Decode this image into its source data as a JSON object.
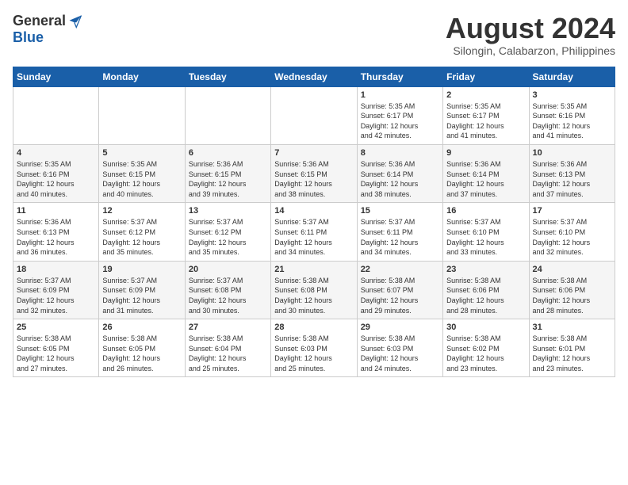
{
  "header": {
    "logo_general": "General",
    "logo_blue": "Blue",
    "month_title": "August 2024",
    "subtitle": "Silongin, Calabarzon, Philippines"
  },
  "days_of_week": [
    "Sunday",
    "Monday",
    "Tuesday",
    "Wednesday",
    "Thursday",
    "Friday",
    "Saturday"
  ],
  "weeks": [
    {
      "days": [
        {
          "num": "",
          "info": ""
        },
        {
          "num": "",
          "info": ""
        },
        {
          "num": "",
          "info": ""
        },
        {
          "num": "",
          "info": ""
        },
        {
          "num": "1",
          "info": "Sunrise: 5:35 AM\nSunset: 6:17 PM\nDaylight: 12 hours\nand 42 minutes."
        },
        {
          "num": "2",
          "info": "Sunrise: 5:35 AM\nSunset: 6:17 PM\nDaylight: 12 hours\nand 41 minutes."
        },
        {
          "num": "3",
          "info": "Sunrise: 5:35 AM\nSunset: 6:16 PM\nDaylight: 12 hours\nand 41 minutes."
        }
      ]
    },
    {
      "days": [
        {
          "num": "4",
          "info": "Sunrise: 5:35 AM\nSunset: 6:16 PM\nDaylight: 12 hours\nand 40 minutes."
        },
        {
          "num": "5",
          "info": "Sunrise: 5:35 AM\nSunset: 6:15 PM\nDaylight: 12 hours\nand 40 minutes."
        },
        {
          "num": "6",
          "info": "Sunrise: 5:36 AM\nSunset: 6:15 PM\nDaylight: 12 hours\nand 39 minutes."
        },
        {
          "num": "7",
          "info": "Sunrise: 5:36 AM\nSunset: 6:15 PM\nDaylight: 12 hours\nand 38 minutes."
        },
        {
          "num": "8",
          "info": "Sunrise: 5:36 AM\nSunset: 6:14 PM\nDaylight: 12 hours\nand 38 minutes."
        },
        {
          "num": "9",
          "info": "Sunrise: 5:36 AM\nSunset: 6:14 PM\nDaylight: 12 hours\nand 37 minutes."
        },
        {
          "num": "10",
          "info": "Sunrise: 5:36 AM\nSunset: 6:13 PM\nDaylight: 12 hours\nand 37 minutes."
        }
      ]
    },
    {
      "days": [
        {
          "num": "11",
          "info": "Sunrise: 5:36 AM\nSunset: 6:13 PM\nDaylight: 12 hours\nand 36 minutes."
        },
        {
          "num": "12",
          "info": "Sunrise: 5:37 AM\nSunset: 6:12 PM\nDaylight: 12 hours\nand 35 minutes."
        },
        {
          "num": "13",
          "info": "Sunrise: 5:37 AM\nSunset: 6:12 PM\nDaylight: 12 hours\nand 35 minutes."
        },
        {
          "num": "14",
          "info": "Sunrise: 5:37 AM\nSunset: 6:11 PM\nDaylight: 12 hours\nand 34 minutes."
        },
        {
          "num": "15",
          "info": "Sunrise: 5:37 AM\nSunset: 6:11 PM\nDaylight: 12 hours\nand 34 minutes."
        },
        {
          "num": "16",
          "info": "Sunrise: 5:37 AM\nSunset: 6:10 PM\nDaylight: 12 hours\nand 33 minutes."
        },
        {
          "num": "17",
          "info": "Sunrise: 5:37 AM\nSunset: 6:10 PM\nDaylight: 12 hours\nand 32 minutes."
        }
      ]
    },
    {
      "days": [
        {
          "num": "18",
          "info": "Sunrise: 5:37 AM\nSunset: 6:09 PM\nDaylight: 12 hours\nand 32 minutes."
        },
        {
          "num": "19",
          "info": "Sunrise: 5:37 AM\nSunset: 6:09 PM\nDaylight: 12 hours\nand 31 minutes."
        },
        {
          "num": "20",
          "info": "Sunrise: 5:37 AM\nSunset: 6:08 PM\nDaylight: 12 hours\nand 30 minutes."
        },
        {
          "num": "21",
          "info": "Sunrise: 5:38 AM\nSunset: 6:08 PM\nDaylight: 12 hours\nand 30 minutes."
        },
        {
          "num": "22",
          "info": "Sunrise: 5:38 AM\nSunset: 6:07 PM\nDaylight: 12 hours\nand 29 minutes."
        },
        {
          "num": "23",
          "info": "Sunrise: 5:38 AM\nSunset: 6:06 PM\nDaylight: 12 hours\nand 28 minutes."
        },
        {
          "num": "24",
          "info": "Sunrise: 5:38 AM\nSunset: 6:06 PM\nDaylight: 12 hours\nand 28 minutes."
        }
      ]
    },
    {
      "days": [
        {
          "num": "25",
          "info": "Sunrise: 5:38 AM\nSunset: 6:05 PM\nDaylight: 12 hours\nand 27 minutes."
        },
        {
          "num": "26",
          "info": "Sunrise: 5:38 AM\nSunset: 6:05 PM\nDaylight: 12 hours\nand 26 minutes."
        },
        {
          "num": "27",
          "info": "Sunrise: 5:38 AM\nSunset: 6:04 PM\nDaylight: 12 hours\nand 25 minutes."
        },
        {
          "num": "28",
          "info": "Sunrise: 5:38 AM\nSunset: 6:03 PM\nDaylight: 12 hours\nand 25 minutes."
        },
        {
          "num": "29",
          "info": "Sunrise: 5:38 AM\nSunset: 6:03 PM\nDaylight: 12 hours\nand 24 minutes."
        },
        {
          "num": "30",
          "info": "Sunrise: 5:38 AM\nSunset: 6:02 PM\nDaylight: 12 hours\nand 23 minutes."
        },
        {
          "num": "31",
          "info": "Sunrise: 5:38 AM\nSunset: 6:01 PM\nDaylight: 12 hours\nand 23 minutes."
        }
      ]
    }
  ]
}
